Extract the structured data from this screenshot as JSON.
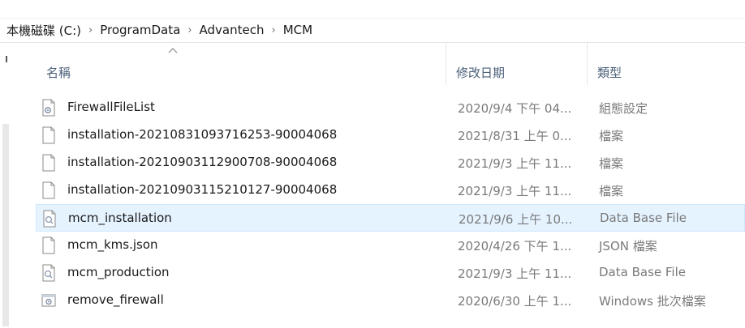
{
  "breadcrumb": [
    "本機磁碟 (C:)",
    "ProgramData",
    "Advantech",
    "MCM"
  ],
  "columns": {
    "name": "名稱",
    "date": "修改日期",
    "type": "類型"
  },
  "sort": {
    "column": "name",
    "direction": "ascending"
  },
  "files": [
    {
      "name": "FirewallFileList",
      "date": "2020/9/4 下午 04...",
      "type": "組態設定",
      "icon": "config-file-icon",
      "selected": false
    },
    {
      "name": "installation-20210831093716253-90004068",
      "date": "2021/8/31 上午 0...",
      "type": "檔案",
      "icon": "file-icon",
      "selected": false
    },
    {
      "name": "installation-20210903112900708-90004068",
      "date": "2021/9/3 上午 11...",
      "type": "檔案",
      "icon": "file-icon",
      "selected": false
    },
    {
      "name": "installation-20210903115210127-90004068",
      "date": "2021/9/3 上午 11...",
      "type": "檔案",
      "icon": "file-icon",
      "selected": false
    },
    {
      "name": "mcm_installation",
      "date": "2021/9/6 上午 10...",
      "type": "Data Base File",
      "icon": "database-file-icon",
      "selected": true
    },
    {
      "name": "mcm_kms.json",
      "date": "2020/4/26 下午 1...",
      "type": "JSON 檔案",
      "icon": "file-icon",
      "selected": false
    },
    {
      "name": "mcm_production",
      "date": "2021/9/3 上午 11...",
      "type": "Data Base File",
      "icon": "database-file-icon",
      "selected": false
    },
    {
      "name": "remove_firewall",
      "date": "2020/6/30 上午 1...",
      "type": "Windows 批次檔案",
      "icon": "batch-file-icon",
      "selected": false
    }
  ],
  "colors": {
    "selection_bg": "#e5f3ff",
    "selection_border": "#cce8ff",
    "header_text": "#4c607a",
    "muted_text": "#7a7a7a"
  }
}
